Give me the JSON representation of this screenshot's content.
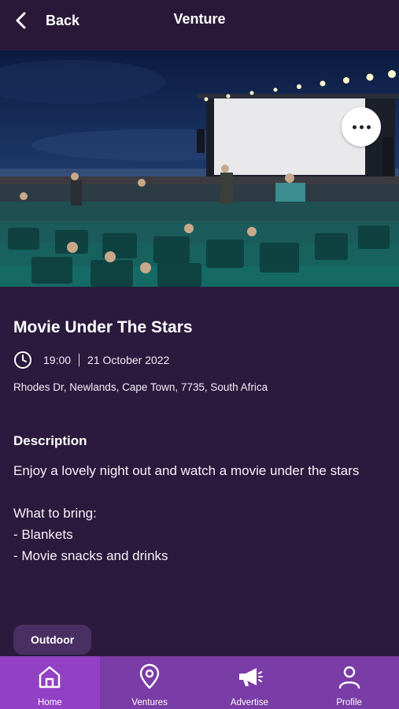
{
  "header": {
    "back_label": "Back",
    "title": "Venture"
  },
  "hero": {
    "description_icon": "photo-outdoor-cinema",
    "more_icon": "more-horizontal-icon"
  },
  "event": {
    "title": "Movie Under The Stars",
    "time": "19:00",
    "date": "21 October 2022",
    "address": "Rhodes Dr, Newlands, Cape Town, 7735, South Africa",
    "description_heading": "Description",
    "description_lines": [
      "Enjoy a lovely night out and watch a movie under the stars",
      "What to bring:",
      "- Blankets",
      "- Movie snacks and drinks"
    ],
    "tag": "Outdoor"
  },
  "nav": {
    "items": [
      {
        "label": "Home",
        "icon": "home-icon",
        "active": true
      },
      {
        "label": "Ventures",
        "icon": "location-pin-icon",
        "active": false
      },
      {
        "label": "Advertise",
        "icon": "megaphone-icon",
        "active": false
      },
      {
        "label": "Profile",
        "icon": "user-icon",
        "active": false
      }
    ]
  },
  "colors": {
    "background": "#2b1a3d",
    "nav_bar": "#7a3ca6",
    "nav_active": "#9241c4",
    "tag_bg": "#4a2f63"
  }
}
